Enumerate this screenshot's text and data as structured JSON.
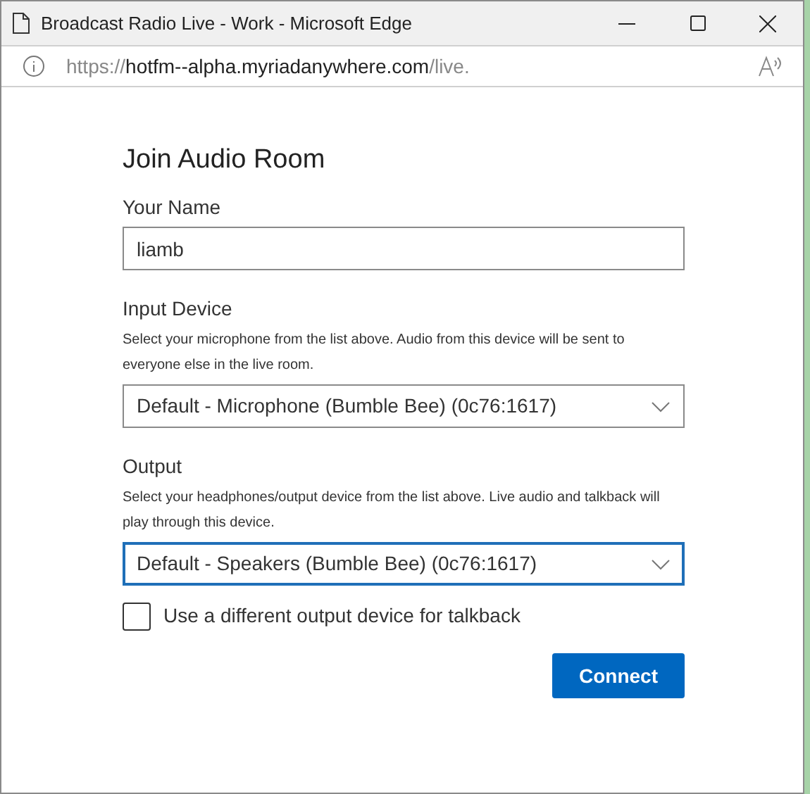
{
  "window": {
    "title": "Broadcast Radio Live - Work - Microsoft Edge"
  },
  "address_bar": {
    "scheme": "https://",
    "host": "hotfm--alpha.myriadanywhere.com",
    "path": "/live."
  },
  "form": {
    "title": "Join Audio Room",
    "fields": [
      {
        "kind": "text",
        "label": "Your Name",
        "value": "liamb"
      },
      {
        "kind": "select",
        "label": "Input Device",
        "help": "Select your microphone from the list above. Audio from this device will be sent to everyone else in the live room.",
        "value": "Default - Microphone (Bumble Bee) (0c76:1617)",
        "focused": false
      },
      {
        "kind": "select",
        "label": "Output",
        "help": "Select your headphones/output device from the list above. Live audio and talkback will play through this device.",
        "value": "Default - Speakers (Bumble Bee) (0c76:1617)",
        "focused": true
      },
      {
        "kind": "checkbox",
        "label": "Use a different output device for talkback",
        "checked": false
      }
    ],
    "button": "Connect"
  }
}
